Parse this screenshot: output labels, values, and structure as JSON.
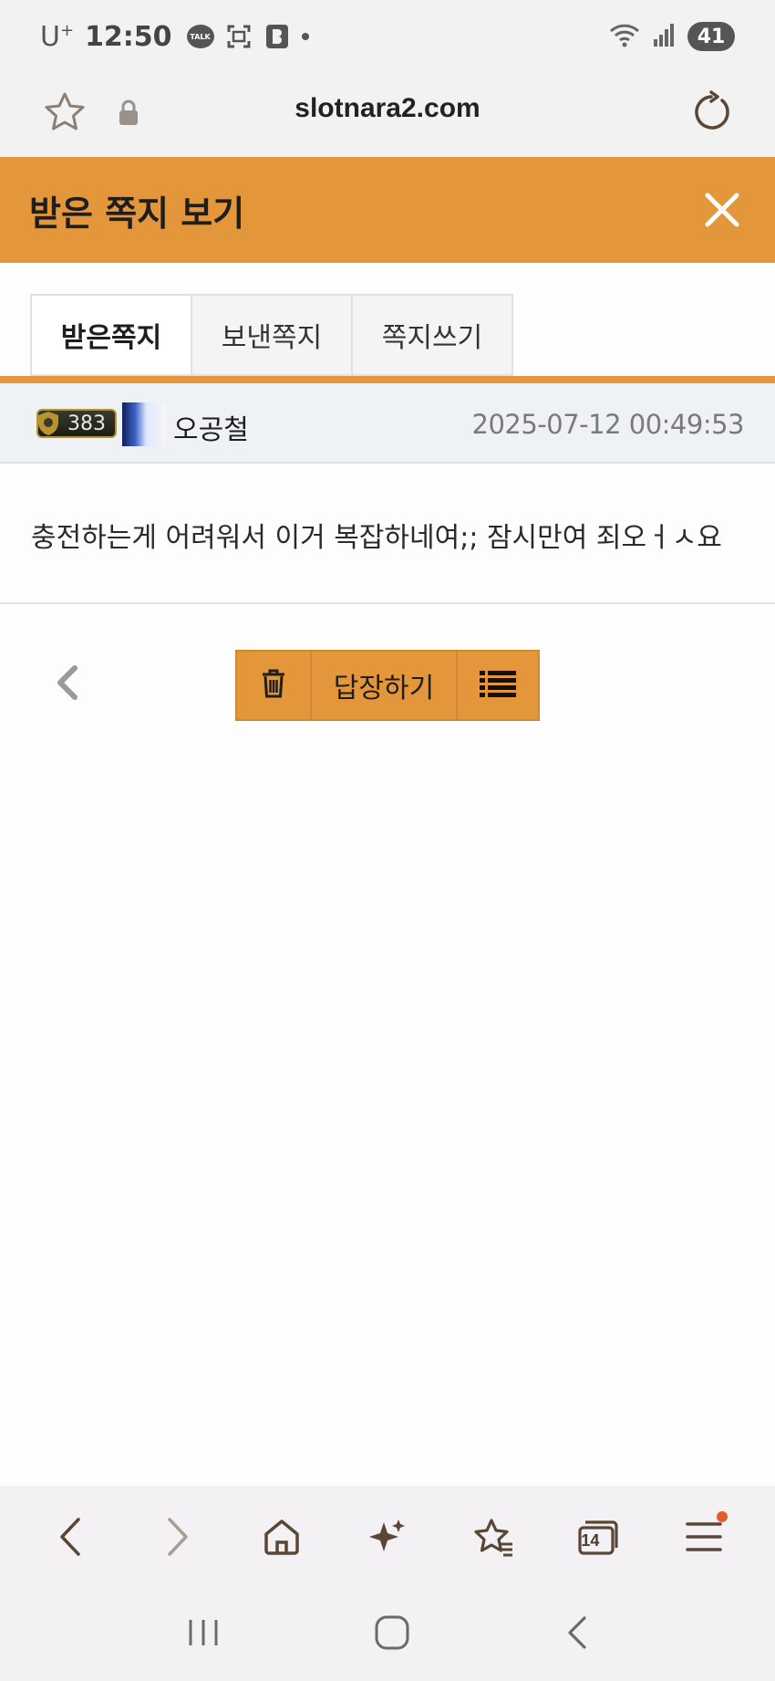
{
  "status_bar": {
    "carrier": "U",
    "carrier_sup": "+",
    "time": "12:50",
    "talk_label": "TALK",
    "battery": "41"
  },
  "browser": {
    "url": "slotnara2.com"
  },
  "header": {
    "title": "받은 쪽지 보기"
  },
  "tabs": [
    {
      "label": "받은쪽지",
      "active": true
    },
    {
      "label": "보낸쪽지",
      "active": false
    },
    {
      "label": "쪽지쓰기",
      "active": false
    }
  ],
  "message": {
    "level": "383",
    "sender": "오공철",
    "date": "2025-07-12 00:49:53",
    "body": "충전하는게 어려워서 이거 복잡하네여;; 잠시만여 죄오ㅓㅅ요"
  },
  "actions": {
    "reply_label": "답장하기"
  },
  "bottom_bar": {
    "tab_count": "14"
  },
  "colors": {
    "accent": "#e4973a",
    "accent_border": "#cf8a31",
    "icon_brown": "#5a4636",
    "notification_dot": "#e25c2b"
  }
}
